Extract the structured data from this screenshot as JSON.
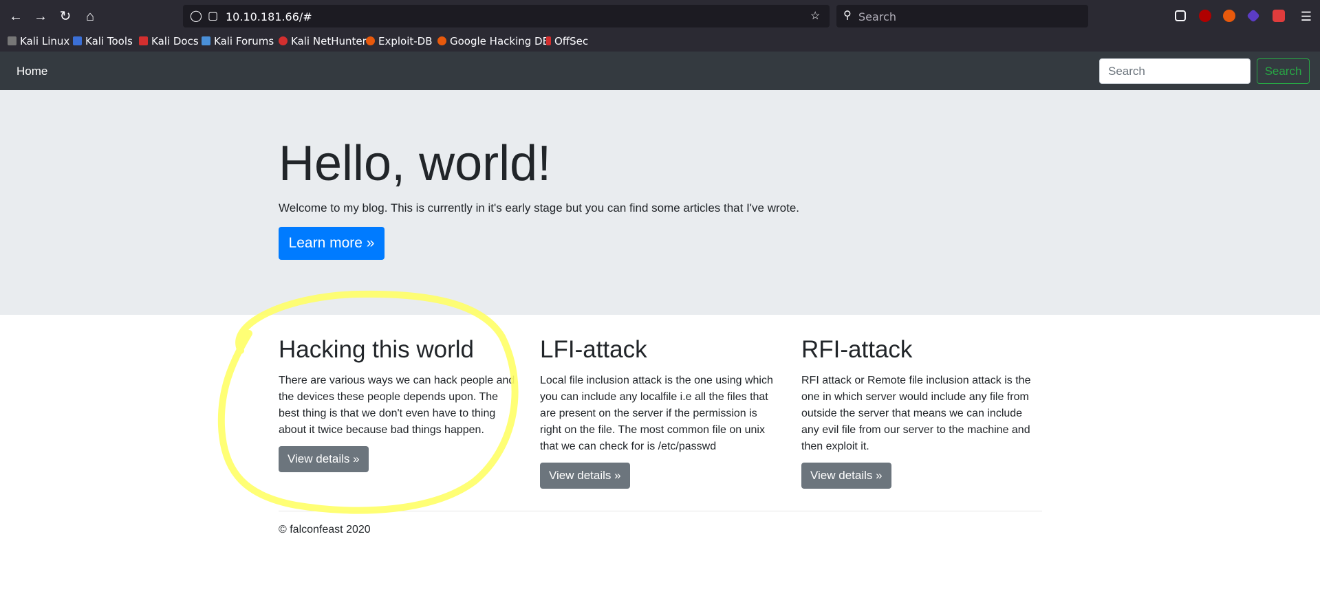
{
  "browser": {
    "url": "10.10.181.66/#",
    "search_placeholder": "Search",
    "bookmarks": [
      {
        "label": "Kali Linux",
        "color": "#555555"
      },
      {
        "label": "Kali Tools",
        "color": "#3b6fd6"
      },
      {
        "label": "Kali Docs",
        "color": "#d32f2f"
      },
      {
        "label": "Kali Forums",
        "color": "#4a90d9"
      },
      {
        "label": "Kali NetHunter",
        "color": "#d32f2f"
      },
      {
        "label": "Exploit-DB",
        "color": "#e8590c"
      },
      {
        "label": "Google Hacking DB",
        "color": "#e8590c"
      },
      {
        "label": "OffSec",
        "color": "#d32f2f"
      }
    ]
  },
  "navbar": {
    "home_label": "Home",
    "search_placeholder": "Search",
    "search_button": "Search"
  },
  "hero": {
    "title": "Hello, world!",
    "lead": "Welcome to my blog. This is currently in it's early stage but you can find some articles that I've wrote.",
    "button": "Learn more »"
  },
  "articles": [
    {
      "title": "Hacking this world",
      "body": "There are various ways we can hack people and the devices these people depends upon. The best thing is that we don't even have to thing about it twice because bad things happen.",
      "button": "View details »"
    },
    {
      "title": "LFI-attack",
      "body": "Local file inclusion attack is the one using which you can include any localfile i.e all the files that are present on the server if the permission is right on the file. The most common file on unix that we can check for is /etc/passwd",
      "button": "View details »"
    },
    {
      "title": "RFI-attack",
      "body": "RFI attack or Remote file inclusion attack is the one in which server would include any file from outside the server that means we can include any evil file from our server to the machine and then exploit it.",
      "button": "View details »"
    }
  ],
  "footer": "© falconfeast 2020",
  "colors": {
    "browser_chrome": "#2b2a33",
    "navbar": "#343a40",
    "jumbotron": "#e9ecef",
    "primary": "#007bff",
    "secondary": "#6c757d",
    "success": "#28a745",
    "highlight": "#ffff66"
  },
  "annotation": {
    "shape": "freehand-circle",
    "color": "#ffff66",
    "target": "Hacking this world"
  }
}
